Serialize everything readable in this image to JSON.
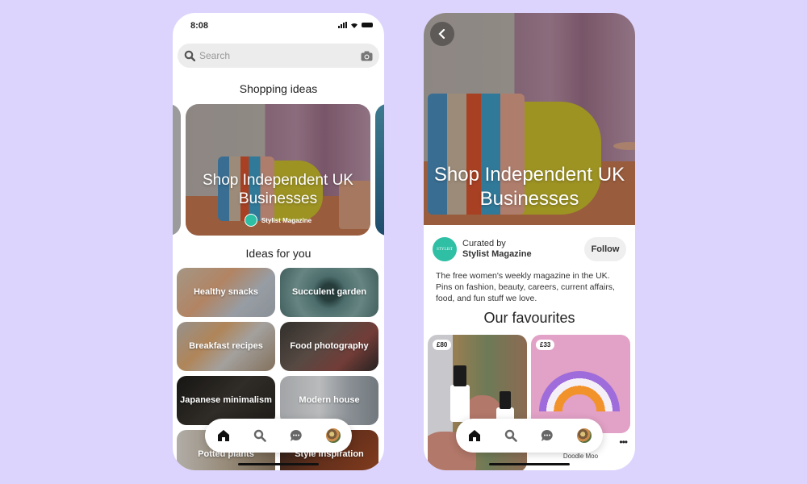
{
  "background_color": "#dcd4fd",
  "left_screen": {
    "status_bar": {
      "time": "8:08"
    },
    "search": {
      "placeholder": "Search",
      "left_icon": "search-icon",
      "right_icon": "camera-icon"
    },
    "shopping_section": {
      "title": "Shopping ideas",
      "hero_card": {
        "title": "Shop Independent UK Businesses",
        "curator": "Stylist Magazine"
      }
    },
    "ideas_section": {
      "title": "Ideas for you",
      "tiles": [
        {
          "label": "Healthy snacks"
        },
        {
          "label": "Succulent garden"
        },
        {
          "label": "Breakfast recipes"
        },
        {
          "label": "Food photography"
        },
        {
          "label": "Japanese minimalism"
        },
        {
          "label": "Modern house"
        },
        {
          "label": "Potted plants"
        },
        {
          "label": "Style inspiration"
        }
      ]
    },
    "bottom_nav": [
      "home-icon",
      "search-icon",
      "messages-icon",
      "profile-avatar"
    ]
  },
  "right_screen": {
    "hero": {
      "title": "Shop Independent UK Businesses",
      "back_icon": "chevron-left-icon"
    },
    "curator": {
      "prefix": "Curated by",
      "name": "Stylist Magazine",
      "avatar_text": "STYLIST",
      "follow_label": "Follow",
      "description": "The free women's weekly magazine in the UK. Pins on fashion, beauty, careers, current affairs, food, and fun stuff we love."
    },
    "favourites": {
      "title": "Our favourites",
      "products": [
        {
          "price": "£80"
        },
        {
          "price": "£33",
          "seller": "Doodle Moo",
          "more_label": "•••"
        }
      ]
    },
    "bottom_nav": [
      "home-icon",
      "search-icon",
      "messages-icon",
      "profile-avatar"
    ]
  }
}
